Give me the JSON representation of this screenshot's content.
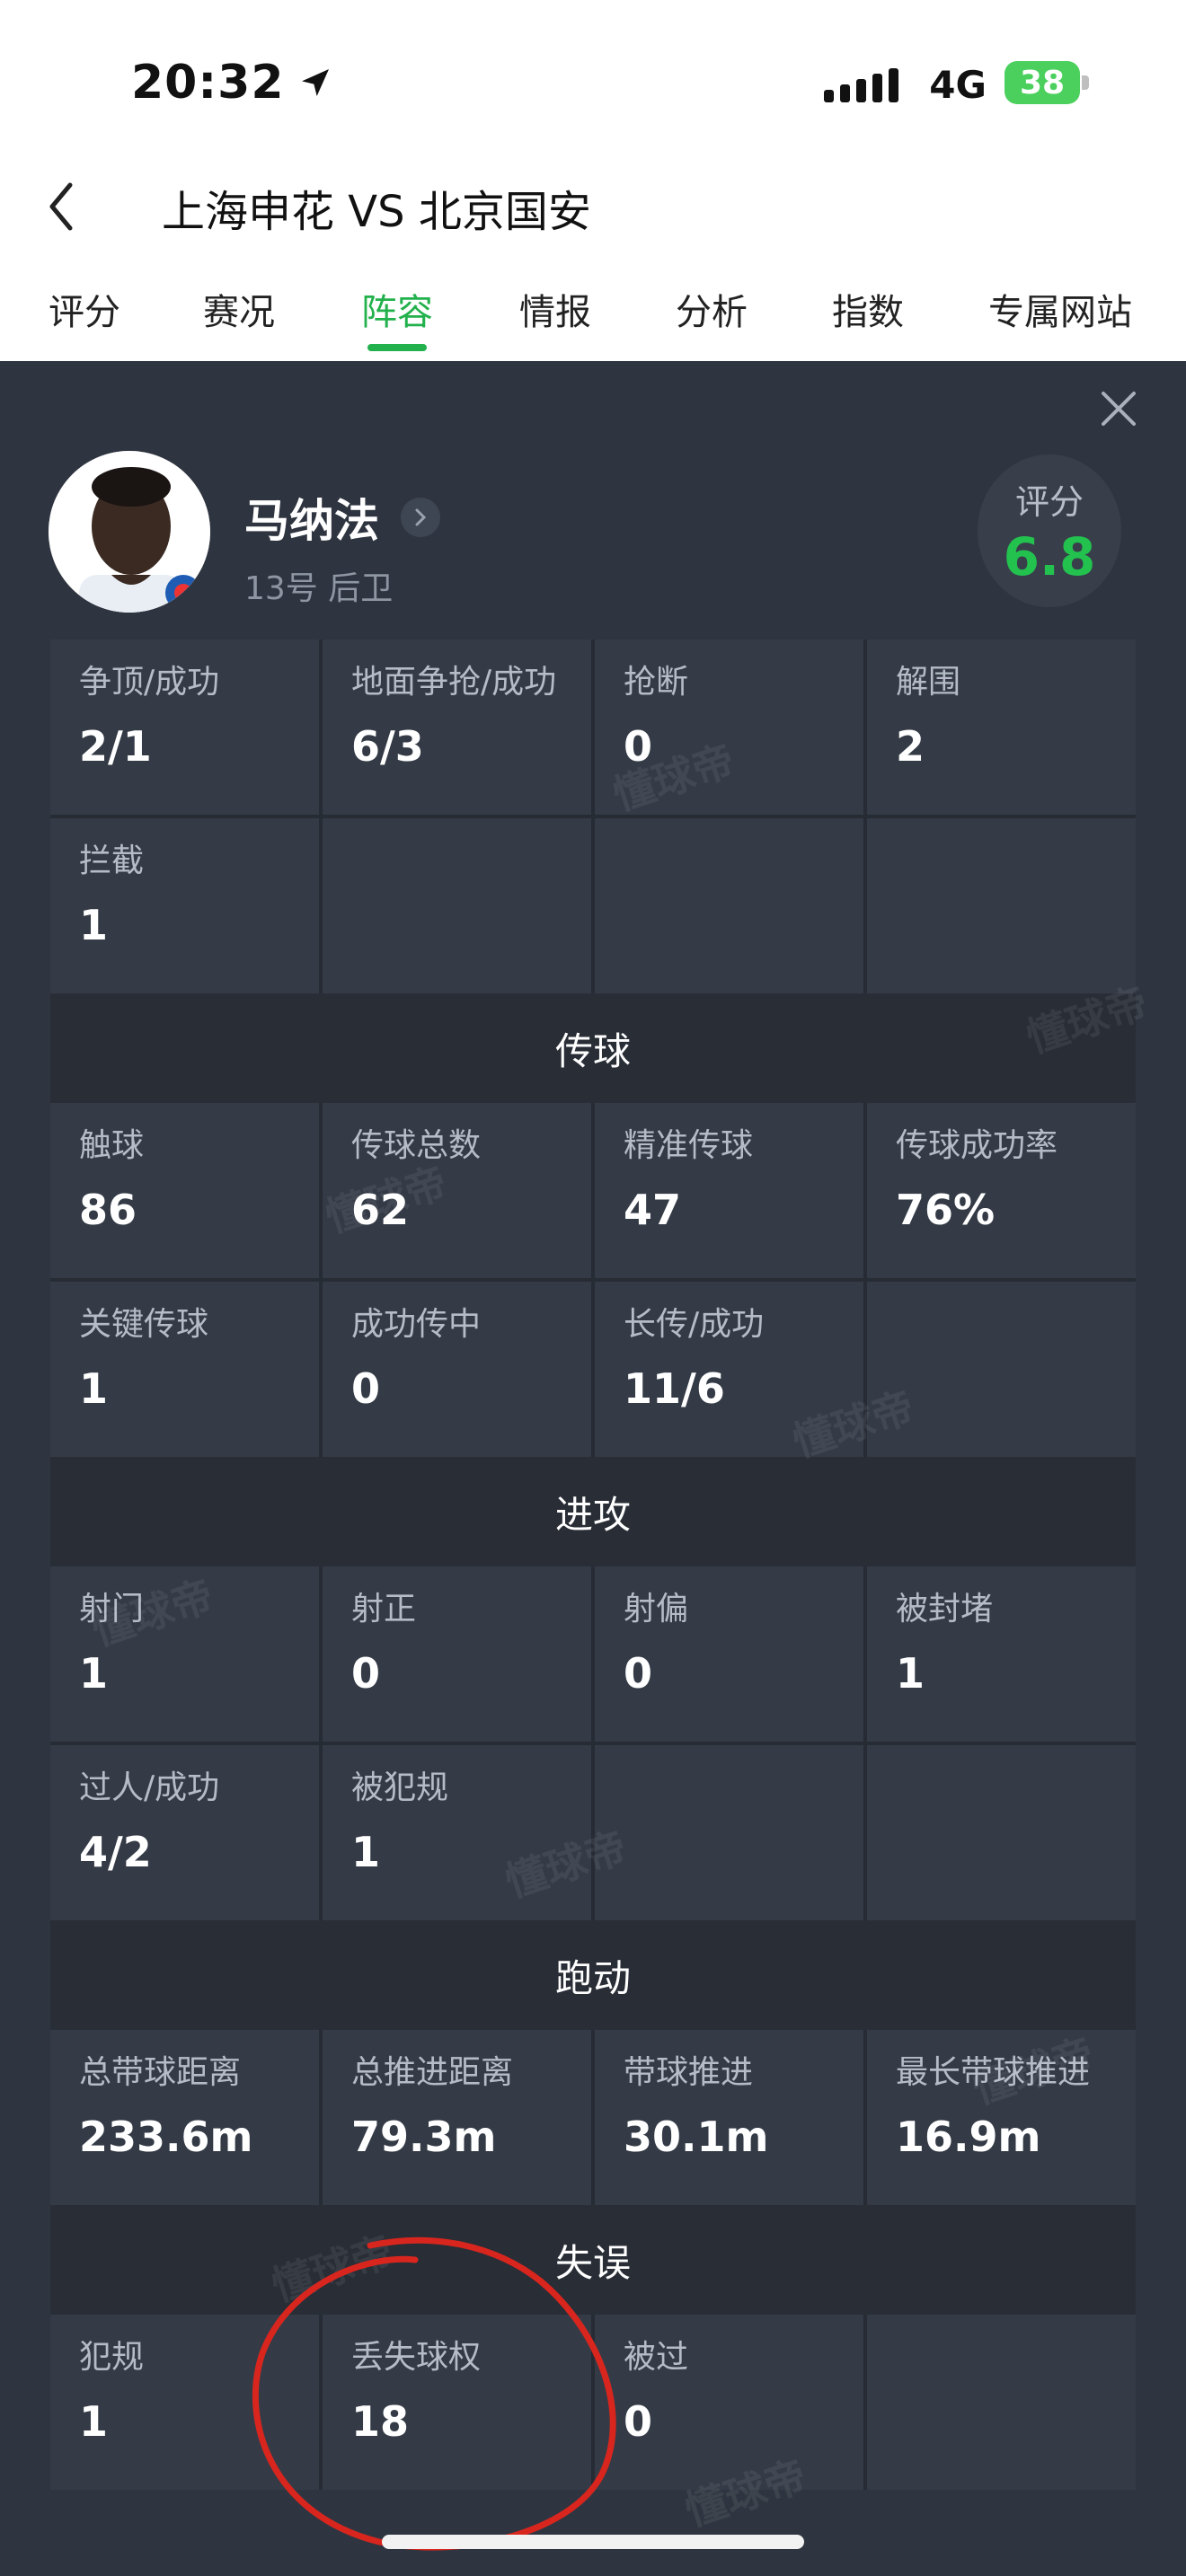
{
  "status_bar": {
    "time": "20:32",
    "network": "4G",
    "battery": "38"
  },
  "header": {
    "title": "上海申花 VS 北京国安",
    "back_icon": "chevron-left-icon"
  },
  "tabs": [
    {
      "label": "评分",
      "active": false
    },
    {
      "label": "赛况",
      "active": false
    },
    {
      "label": "阵容",
      "active": true
    },
    {
      "label": "情报",
      "active": false
    },
    {
      "label": "分析",
      "active": false
    },
    {
      "label": "指数",
      "active": false
    },
    {
      "label": "专属网站",
      "active": false
    }
  ],
  "player": {
    "name": "马纳法",
    "meta": "13号 后卫",
    "rating_label": "评分",
    "rating": "6.8"
  },
  "watermark": "懂球帝",
  "defense": [
    {
      "label": "争顶/成功",
      "value": "2/1"
    },
    {
      "label": "地面争抢/成功",
      "value": "6/3"
    },
    {
      "label": "抢断",
      "value": "0"
    },
    {
      "label": "解围",
      "value": "2"
    },
    {
      "label": "拦截",
      "value": "1"
    }
  ],
  "passing_title": "传球",
  "passing": [
    {
      "label": "触球",
      "value": "86"
    },
    {
      "label": "传球总数",
      "value": "62"
    },
    {
      "label": "精准传球",
      "value": "47"
    },
    {
      "label": "传球成功率",
      "value": "76%"
    },
    {
      "label": "关键传球",
      "value": "1"
    },
    {
      "label": "成功传中",
      "value": "0"
    },
    {
      "label": "长传/成功",
      "value": "11/6"
    }
  ],
  "attack_title": "进攻",
  "attack": [
    {
      "label": "射门",
      "value": "1"
    },
    {
      "label": "射正",
      "value": "0"
    },
    {
      "label": "射偏",
      "value": "0"
    },
    {
      "label": "被封堵",
      "value": "1"
    },
    {
      "label": "过人/成功",
      "value": "4/2"
    },
    {
      "label": "被犯规",
      "value": "1"
    }
  ],
  "running_title": "跑动",
  "running": [
    {
      "label": "总带球距离",
      "value": "233.6m"
    },
    {
      "label": "总推进距离",
      "value": "79.3m"
    },
    {
      "label": "带球推进",
      "value": "30.1m"
    },
    {
      "label": "最长带球推进",
      "value": "16.9m"
    }
  ],
  "errors_title": "失误",
  "errors": [
    {
      "label": "犯规",
      "value": "1"
    },
    {
      "label": "丢失球权",
      "value": "18"
    },
    {
      "label": "被过",
      "value": "0"
    }
  ],
  "colors": {
    "accent": "#22b14c",
    "rating": "#23c24f",
    "panel": "#2f3540",
    "annotation": "#d8261e"
  }
}
